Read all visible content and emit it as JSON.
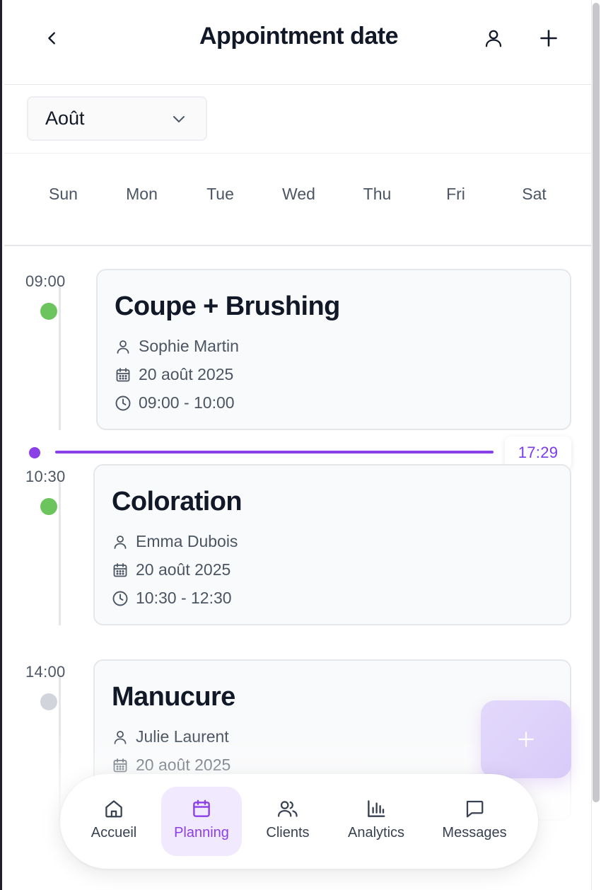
{
  "header": {
    "title": "Appointment date"
  },
  "month_select": {
    "value": "Août"
  },
  "weekdays": [
    "Sun",
    "Mon",
    "Tue",
    "Wed",
    "Thu",
    "Fri",
    "Sat"
  ],
  "now_time": "17:29",
  "appointments": [
    {
      "time": "09:00",
      "service": "Coupe + Brushing",
      "client": "Sophie Martin",
      "date": "20 août 2025",
      "range": "09:00 - 10:00",
      "status_color": "#6cc45d"
    },
    {
      "time": "10:30",
      "service": "Coloration",
      "client": "Emma Dubois",
      "date": "20 août 2025",
      "range": "10:30 - 12:30",
      "status_color": "#6cc45d"
    },
    {
      "time": "14:00",
      "service": "Manucure",
      "client": "Julie Laurent",
      "date": "20 août 2025",
      "range": "",
      "status_color": "#d1d5db"
    }
  ],
  "nav": {
    "items": [
      {
        "label": "Accueil",
        "icon": "home-icon"
      },
      {
        "label": "Planning",
        "icon": "calendar-icon",
        "active": true
      },
      {
        "label": "Clients",
        "icon": "users-icon"
      },
      {
        "label": "Analytics",
        "icon": "bar-chart-icon"
      },
      {
        "label": "Messages",
        "icon": "message-icon"
      }
    ]
  },
  "colors": {
    "accent": "#8b3fe8",
    "confirmed": "#6cc45d",
    "pending": "#d1d5db"
  }
}
